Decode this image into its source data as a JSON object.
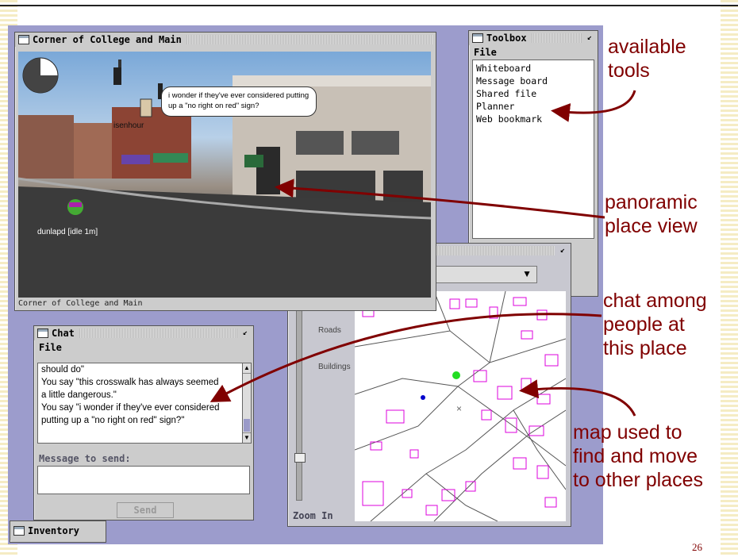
{
  "page_number": "26",
  "callouts": {
    "tools": [
      "available",
      "tools"
    ],
    "panorama": [
      "panoramic",
      "place view"
    ],
    "chat": [
      "chat among",
      "people at",
      "this place"
    ],
    "map": [
      "map used to",
      "find and move",
      "to other places"
    ]
  },
  "place_window": {
    "title": "Corner of College and Main",
    "status": "Corner of College and Main",
    "speech_bubble": "i wonder if they've ever considered putting up a \"no right on red\" sign?",
    "user1": "isenhour",
    "user2": "dunlapd [idle 1m]"
  },
  "toolbox": {
    "title": "Toolbox",
    "menu": "File",
    "items": [
      "Whiteboard",
      "Message board",
      "Shared file",
      "Planner",
      "Web bookmark"
    ]
  },
  "chat": {
    "title": "Chat",
    "menu": "File",
    "lines": [
      "should do\"",
      "You say \"this crosswalk has always seemed",
      "a little dangerous.\"",
      "You say \"i wonder if they've ever considered",
      "putting up a \"no right on red\" sign?\""
    ],
    "message_label": "Message to send:",
    "send_label": "Send"
  },
  "map_window": {
    "layer_roads": "Roads",
    "layer_buildings": "Buildings",
    "zoom_label": "Zoom In"
  },
  "inventory": {
    "label": "Inventory"
  }
}
